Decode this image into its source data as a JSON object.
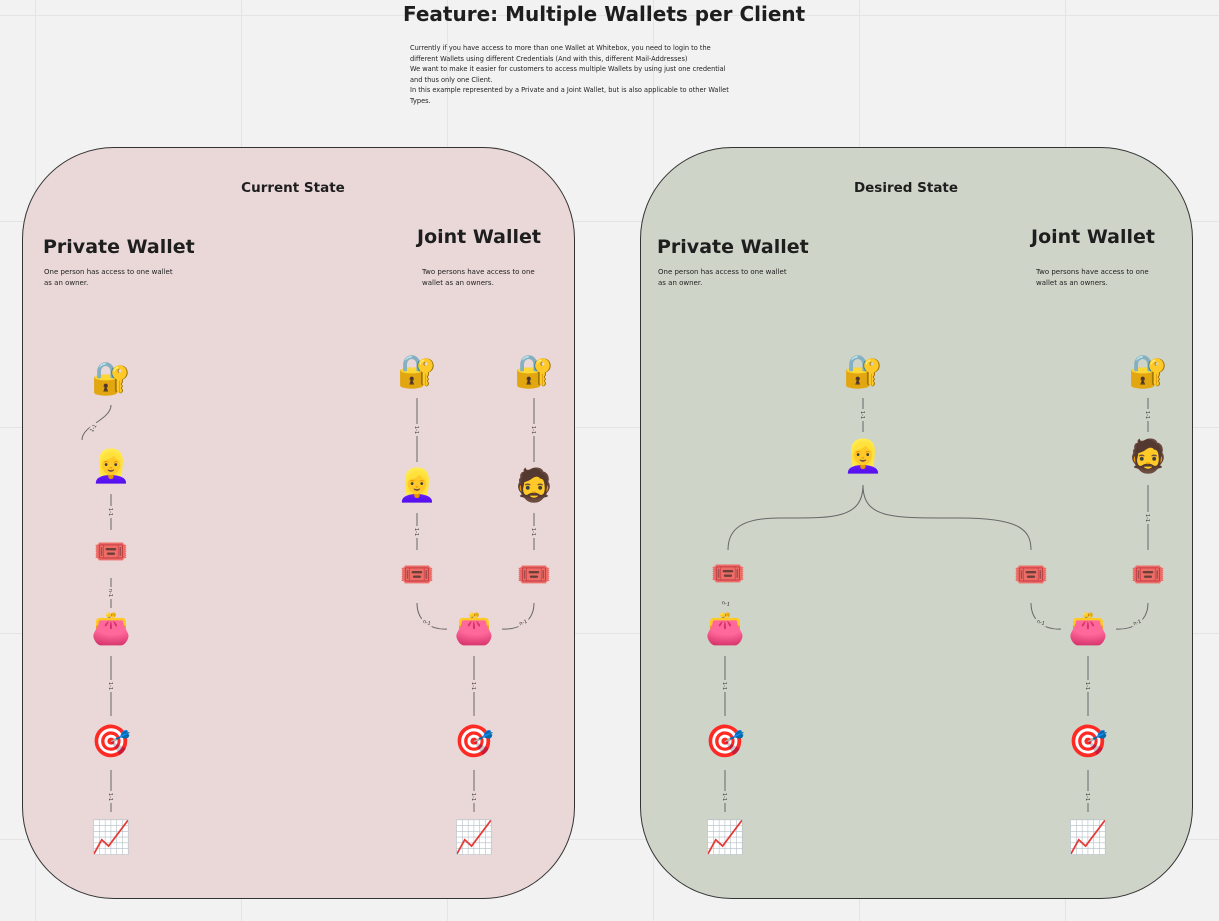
{
  "header": {
    "title": "Feature: Multiple Wallets per Client",
    "description": [
      "Currently if you have access to more than one Wallet at Whitebox, you need to login to the different Wallets using different Credentials (And with this, different Mail-Addresses)",
      "We want to make it easier for customers to access multiple Wallets by using just one credential and thus only one Client.",
      "In this example represented by a Private and a Joint Wallet, but is also applicable to other Wallet Types."
    ]
  },
  "current": {
    "title": "Current State",
    "private": {
      "title": "Private Wallet",
      "desc": "One person has access to one wallet as an owner."
    },
    "joint": {
      "title": "Joint Wallet",
      "desc": "Two persons have access to one wallet as an owners."
    }
  },
  "desired": {
    "title": "Desired State",
    "private": {
      "title": "Private Wallet",
      "desc": "One person has access to one wallet as an owner."
    },
    "joint": {
      "title": "Joint Wallet",
      "desc": "Two persons have access to one wallet as an owners."
    }
  },
  "relations": {
    "one_to_one": "1-1",
    "n_to_one": "n-1"
  },
  "icons": {
    "lock": "🔐",
    "woman": "👱‍♀️",
    "man": "🧔",
    "ticket": "🎟️",
    "wallet": "👛",
    "target": "🎯",
    "chart": "📈"
  },
  "colors": {
    "current_bg": "#ead8d8",
    "desired_bg": "#cfd4c9",
    "connector": "#666666"
  }
}
